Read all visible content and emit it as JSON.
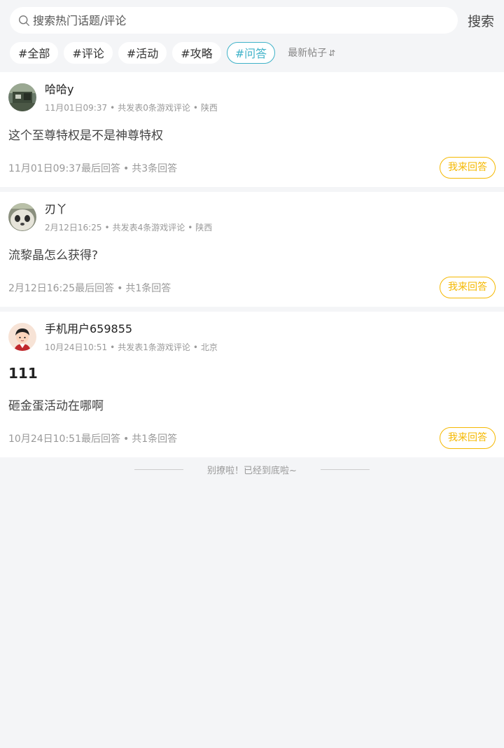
{
  "search": {
    "placeholder": "搜索热门话题/评论",
    "button_label": "搜索"
  },
  "tags": [
    {
      "label": "#全部"
    },
    {
      "label": "#评论"
    },
    {
      "label": "#活动"
    },
    {
      "label": "#攻略"
    },
    {
      "label": "#问答",
      "active": true
    }
  ],
  "sort": {
    "label": "最新帖子",
    "icon": "sort-arrows-icon"
  },
  "colors": {
    "accent": "#3fb2c8",
    "answer_button": "#f5b800",
    "background": "#f4f5f7"
  },
  "posts": [
    {
      "author": "哈哈y",
      "time": "11月01日09:37",
      "stats": "共发表0条游戏评论",
      "location": "陕西",
      "title": "",
      "body": "这个至尊特权是不是神尊特权",
      "last_reply": "11月01日09:37最后回答",
      "answer_count": "共3条回答",
      "answer_label": "我来回答"
    },
    {
      "author": "刃丫",
      "time": "2月12日16:25",
      "stats": "共发表4条游戏评论",
      "location": "陕西",
      "title": "",
      "body": "流黎晶怎么获得?",
      "last_reply": "2月12日16:25最后回答",
      "answer_count": "共1条回答",
      "answer_label": "我来回答"
    },
    {
      "author": "手机用户659855",
      "time": "10月24日10:51",
      "stats": "共发表1条游戏评论",
      "location": "北京",
      "title": "111",
      "body": "砸金蛋活动在哪啊",
      "last_reply": "10月24日10:51最后回答",
      "answer_count": "共1条回答",
      "answer_label": "我来回答"
    }
  ],
  "footer": {
    "end_text": "别撩啦！已经到底啦~"
  }
}
